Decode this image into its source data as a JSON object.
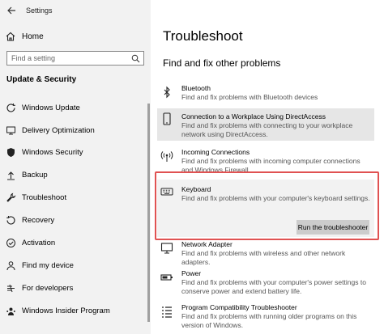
{
  "window": {
    "title": "Settings"
  },
  "sidebar": {
    "home_label": "Home",
    "search_placeholder": "Find a setting",
    "section_title": "Update & Security",
    "items": [
      {
        "label": "Windows Update",
        "icon": "sync-icon"
      },
      {
        "label": "Delivery Optimization",
        "icon": "delivery-icon"
      },
      {
        "label": "Windows Security",
        "icon": "shield-icon"
      },
      {
        "label": "Backup",
        "icon": "backup-icon"
      },
      {
        "label": "Troubleshoot",
        "icon": "wrench-icon"
      },
      {
        "label": "Recovery",
        "icon": "recovery-icon"
      },
      {
        "label": "Activation",
        "icon": "activation-icon"
      },
      {
        "label": "Find my device",
        "icon": "person-locate-icon"
      },
      {
        "label": "For developers",
        "icon": "developer-icon"
      },
      {
        "label": "Windows Insider Program",
        "icon": "insider-icon"
      }
    ]
  },
  "main": {
    "title": "Troubleshoot",
    "subheading": "Find and fix other problems",
    "items": [
      {
        "name": "Bluetooth",
        "description": "Find and fix problems with Bluetooth devices",
        "icon": "bluetooth-icon"
      },
      {
        "name": "Connection to a Workplace Using DirectAccess",
        "description": "Find and fix problems with connecting to your workplace network using DirectAccess.",
        "icon": "phone-icon"
      },
      {
        "name": "Incoming Connections",
        "description": "Find and fix problems with incoming computer connections and Windows Firewall.",
        "icon": "antenna-icon"
      },
      {
        "name": "Keyboard",
        "description": "Find and fix problems with your computer's keyboard settings.",
        "icon": "keyboard-icon",
        "button": "Run the troubleshooter"
      },
      {
        "name": "Network Adapter",
        "description": "Find and fix problems with wireless and other network adapters.",
        "icon": "monitor-icon"
      },
      {
        "name": "Power",
        "description": "Find and fix problems with your computer's power settings to conserve power and extend battery life.",
        "icon": "battery-icon"
      },
      {
        "name": "Program Compatibility Troubleshooter",
        "description": "Find and fix problems with running older programs on this version of Windows.",
        "icon": "list-icon"
      }
    ]
  },
  "colors": {
    "highlight": "#e05252",
    "sidebar_bg": "#f2f2f2",
    "button_bg": "#cccccc"
  }
}
